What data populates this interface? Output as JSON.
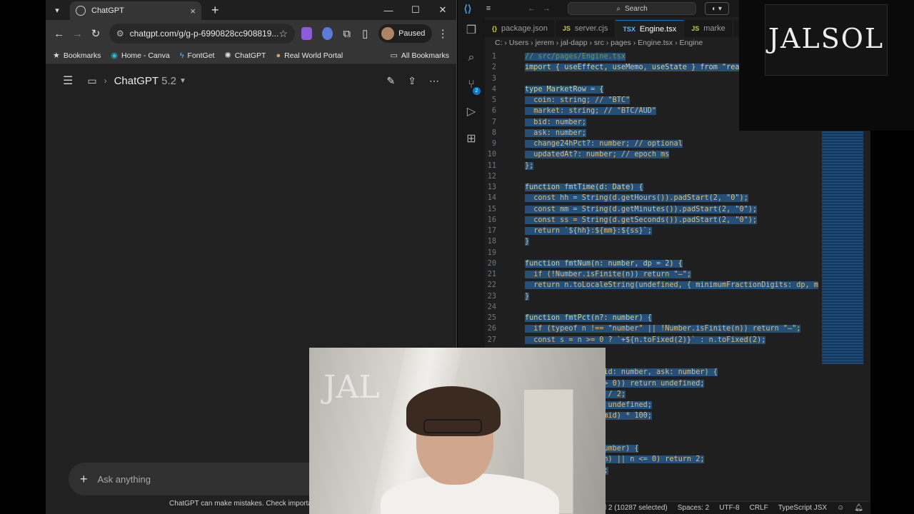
{
  "browser": {
    "tab_title": "ChatGPT",
    "url": "chatgpt.com/g/g-p-6990828cc908819...",
    "profile_status": "Paused",
    "bookmarks": [
      {
        "label": "Bookmarks",
        "icon": "star-icon"
      },
      {
        "label": "Home - Canva",
        "icon": "canva-icon"
      },
      {
        "label": "FontGet",
        "icon": "bolt-icon"
      },
      {
        "label": "ChatGPT",
        "icon": "openai-icon"
      },
      {
        "label": "Real World Portal",
        "icon": "portal-icon"
      }
    ],
    "all_bookmarks": "All Bookmarks"
  },
  "chat": {
    "model_name": "ChatGPT",
    "model_version": "5.2",
    "composer_placeholder": "Ask anything",
    "disclaimer": "ChatGPT can make mistakes. Check important info."
  },
  "vscode": {
    "search_placeholder": "Search",
    "tabs": [
      {
        "label": "package.json",
        "icon": "{}"
      },
      {
        "label": "server.cjs",
        "icon": "JS"
      },
      {
        "label": "Engine.tsx",
        "icon": "TSX",
        "active": true
      },
      {
        "label": "marke",
        "icon": "JS"
      }
    ],
    "breadcrumbs": "C: › Users › jerem › jal-dapp › src › pages › Engine.tsx › Engine",
    "code_lines": [
      {
        "n": "1",
        "t": "// src/pages/Engine.tsx"
      },
      {
        "n": "2",
        "t": "import { useEffect, useMemo, useState } from \"rea"
      },
      {
        "n": "3",
        "t": ""
      },
      {
        "n": "4",
        "t": "type MarketRow = {"
      },
      {
        "n": "5",
        "t": "  coin: string; // \"BTC\""
      },
      {
        "n": "6",
        "t": "  market: string; // \"BTC/AUD\""
      },
      {
        "n": "7",
        "t": "  bid: number;"
      },
      {
        "n": "8",
        "t": "  ask: number;"
      },
      {
        "n": "9",
        "t": "  change24hPct?: number; // optional"
      },
      {
        "n": "10",
        "t": "  updatedAt?: number; // epoch ms"
      },
      {
        "n": "11",
        "t": "};"
      },
      {
        "n": "12",
        "t": ""
      },
      {
        "n": "13",
        "t": "function fmtTime(d: Date) {"
      },
      {
        "n": "14",
        "t": "  const hh = String(d.getHours()).padStart(2, \"0\");"
      },
      {
        "n": "15",
        "t": "  const mm = String(d.getMinutes()).padStart(2, \"0\");"
      },
      {
        "n": "16",
        "t": "  const ss = String(d.getSeconds()).padStart(2, \"0\");"
      },
      {
        "n": "17",
        "t": "  return `${hh}:${mm}:${ss}`;"
      },
      {
        "n": "18",
        "t": "}"
      },
      {
        "n": "19",
        "t": ""
      },
      {
        "n": "20",
        "t": "function fmtNum(n: number, dp = 2) {"
      },
      {
        "n": "21",
        "t": "  if (!Number.isFinite(n)) return \"—\";"
      },
      {
        "n": "22",
        "t": "  return n.toLocaleString(undefined, { minimumFractionDigits: dp, m"
      },
      {
        "n": "23",
        "t": "}"
      },
      {
        "n": "24",
        "t": ""
      },
      {
        "n": "25",
        "t": "function fmtPct(n?: number) {"
      },
      {
        "n": "26",
        "t": "  if (typeof n !== \"number\" || !Number.isFinite(n)) return \"—\";"
      },
      {
        "n": "27",
        "t": "  const s = n >= 0 ? `+${n.toFixed(2)}` : n.toFixed(2);"
      },
      {
        "n": "",
        "t": ""
      },
      {
        "n": "",
        "t": ""
      },
      {
        "n": "",
        "t": "            dPct(bid: number, ask: number) {"
      },
      {
        "n": "",
        "t": "            !(ask > 0)) return undefined;"
      },
      {
        "n": "",
        "t": "            + ask) / 2;"
      },
      {
        "n": "",
        "t": "            return undefined;"
      },
      {
        "n": "",
        "t": "            id) / mid) * 100;"
      },
      {
        "n": "",
        "t": ""
      },
      {
        "n": "",
        "t": ""
      },
      {
        "n": "",
        "t": "            e(n: number) {"
      },
      {
        "n": "",
        "t": "            inite(n) || n <= 0) return 2;"
      },
      {
        "n": "",
        "t": "            turn 8;"
      },
      {
        "n": "",
        "t": "            n 6;"
      }
    ],
    "status": {
      "cursor": ", Col 2 (10287 selected)",
      "spaces": "Spaces: 2",
      "encoding": "UTF-8",
      "eol": "CRLF",
      "language": "TypeScript JSX"
    }
  },
  "overlay": {
    "logo_text": "JALSOL"
  },
  "colors": {
    "accent": "#0078d4",
    "selection": "#264f78",
    "chat_bg": "#212121"
  }
}
